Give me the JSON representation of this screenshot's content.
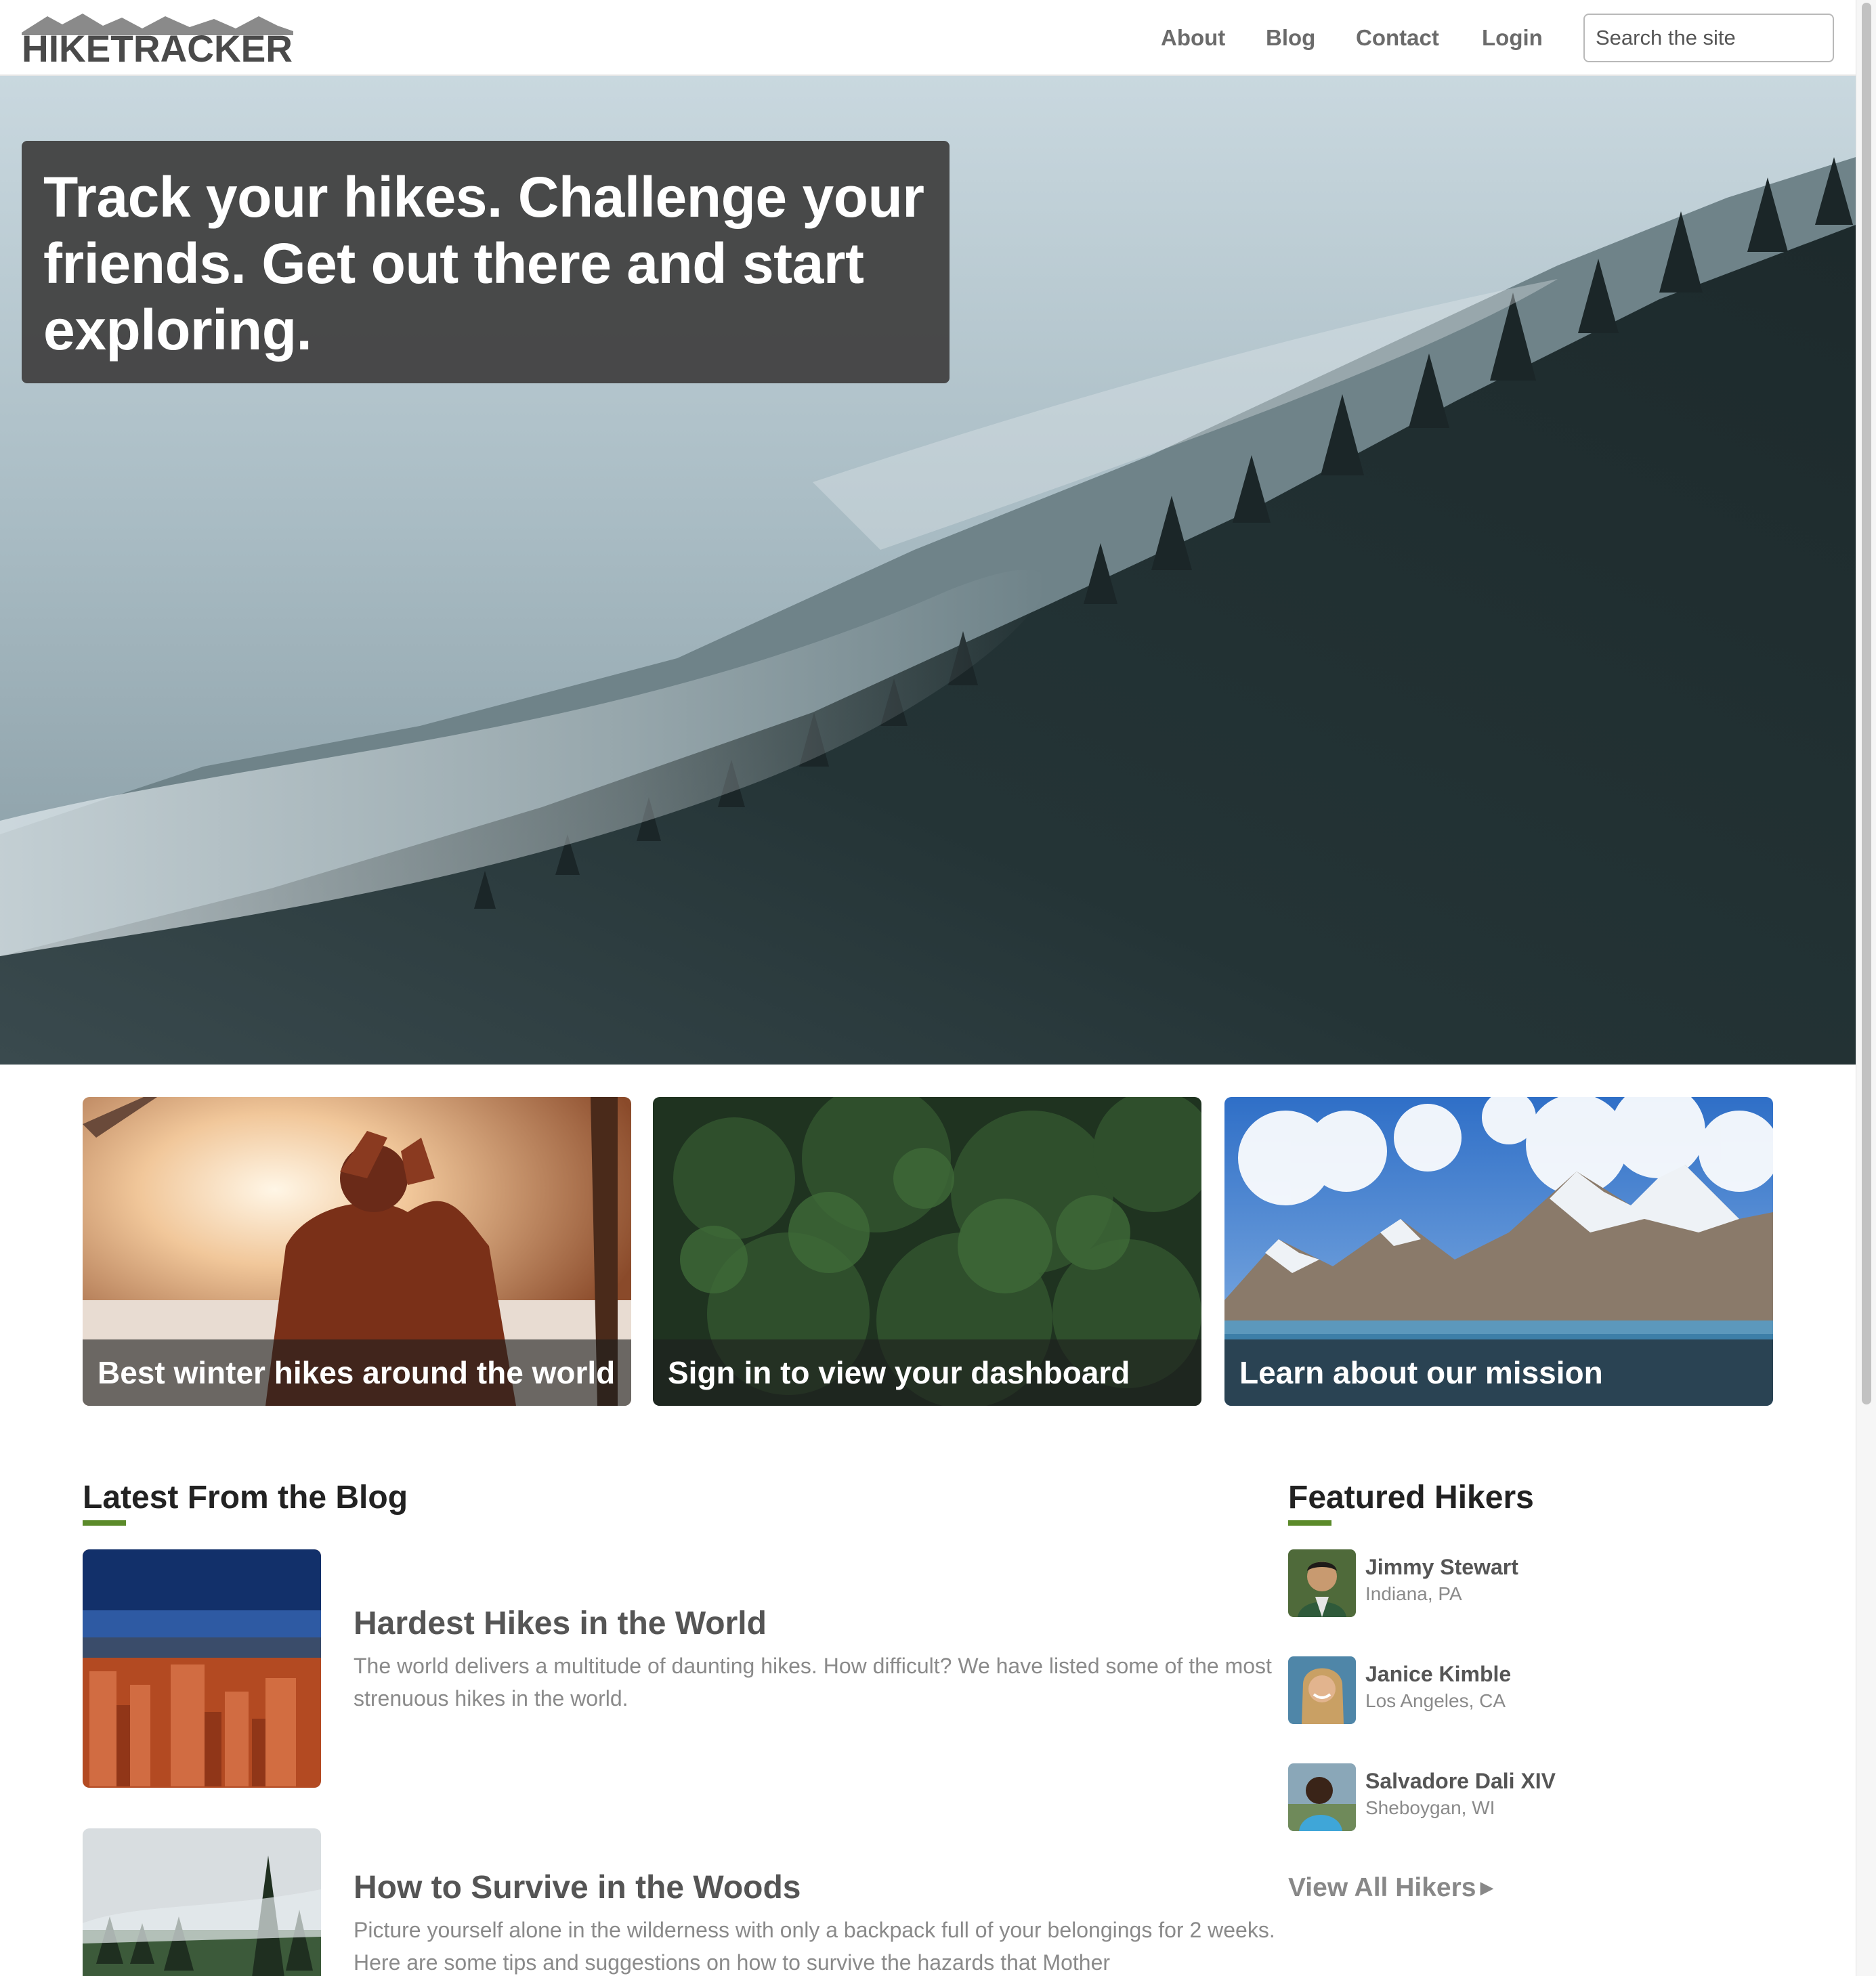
{
  "brand": {
    "logo_text": "HIKETRACKER"
  },
  "nav": {
    "items": [
      {
        "label": "About"
      },
      {
        "label": "Blog"
      },
      {
        "label": "Contact"
      },
      {
        "label": "Login"
      }
    ],
    "search_placeholder": "Search the site"
  },
  "hero": {
    "headline": "Track your hikes. Challenge your friends. Get out there and start exploring."
  },
  "cards": [
    {
      "label": "Best winter hikes around the world"
    },
    {
      "label": "Sign in to view your dashboard"
    },
    {
      "label": "Learn about our mission"
    }
  ],
  "blog": {
    "title": "Latest From the Blog",
    "posts": [
      {
        "title": "Hardest Hikes in the World",
        "excerpt": "The world delivers a multitude of daunting hikes. How difficult? We have listed some of the most strenuous hikes in the world."
      },
      {
        "title": "How to Survive in the Woods",
        "excerpt": "Picture yourself alone in the wilderness with only a backpack full of your belongings for 2 weeks. Here are some tips and suggestions on how to survive the hazards that Mother"
      }
    ]
  },
  "hikers": {
    "title": "Featured Hikers",
    "items": [
      {
        "name": "Jimmy Stewart",
        "location": "Indiana, PA"
      },
      {
        "name": "Janice Kimble",
        "location": "Los Angeles, CA"
      },
      {
        "name": "Salvadore Dali XIV",
        "location": "Sheboygan, WI"
      }
    ],
    "view_all": "View All Hikers"
  },
  "colors": {
    "accent_green": "#5b8a2a",
    "hero_box": "#444444",
    "nav_text": "#6b6b6b"
  }
}
